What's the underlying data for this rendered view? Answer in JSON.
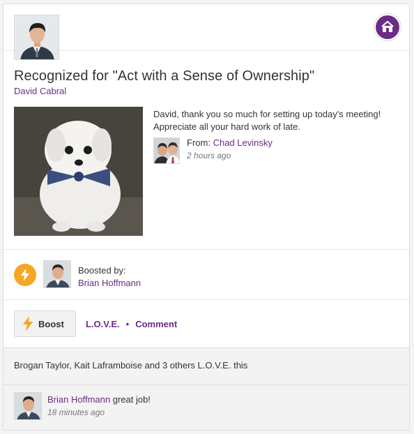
{
  "header": {
    "recipient_avatar_icon": "person-avatar-icon",
    "badge_icon": "award-badge-icon",
    "badge_color": "#6b2c86"
  },
  "post": {
    "title": "Recognized for \"Act with a Sense of Ownership\"",
    "recipient": "David Cabral",
    "photo_icon": "dog-photo",
    "message": "David, thank you so much for setting up today's meeting! Appreciate all your hard work of late.",
    "from_label": "From:",
    "from_name": "Chad Levinsky",
    "time": "2 hours ago"
  },
  "boosts": {
    "icon": "lightning-bolt-icon",
    "label": "Boosted by:",
    "name": "Brian Hoffmann"
  },
  "actions": {
    "boost_label": "Boost",
    "love_label": "L.O.V.E.",
    "separator": "•",
    "comment_label": "Comment"
  },
  "footer": {
    "likes_text": "Brogan Taylor, Kait Laframboise and 3 others L.O.V.E. this",
    "comment": {
      "author": "Brian Hoffmann",
      "text": "great job!",
      "time": "18 minutes ago"
    }
  },
  "colors": {
    "accent": "#6b2c86",
    "boost": "#f5a623"
  }
}
